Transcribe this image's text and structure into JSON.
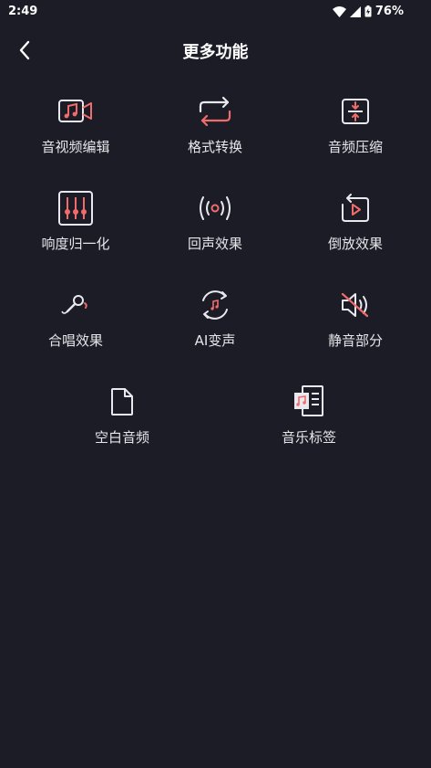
{
  "status": {
    "time": "2:49",
    "battery": "76%"
  },
  "header": {
    "title": "更多功能"
  },
  "features": [
    {
      "label": "音视频编辑",
      "icon": "video-music-icon"
    },
    {
      "label": "格式转换",
      "icon": "repeat-arrows-icon"
    },
    {
      "label": "音频压缩",
      "icon": "compress-icon"
    },
    {
      "label": "响度归一化",
      "icon": "equalizer-sliders-icon"
    },
    {
      "label": "回声效果",
      "icon": "broadcast-icon"
    },
    {
      "label": "倒放效果",
      "icon": "reverse-play-icon"
    },
    {
      "label": "合唱效果",
      "icon": "microphone-icon"
    },
    {
      "label": "AI变声",
      "icon": "voice-changer-icon"
    },
    {
      "label": "静音部分",
      "icon": "mute-speaker-icon"
    },
    {
      "label": "空白音频",
      "icon": "blank-file-icon"
    },
    {
      "label": "音乐标签",
      "icon": "music-tag-icon"
    }
  ],
  "colors": {
    "background": "#1c1c26",
    "accent": "#f06c6c",
    "icon_stroke": "#e8e8ee"
  }
}
